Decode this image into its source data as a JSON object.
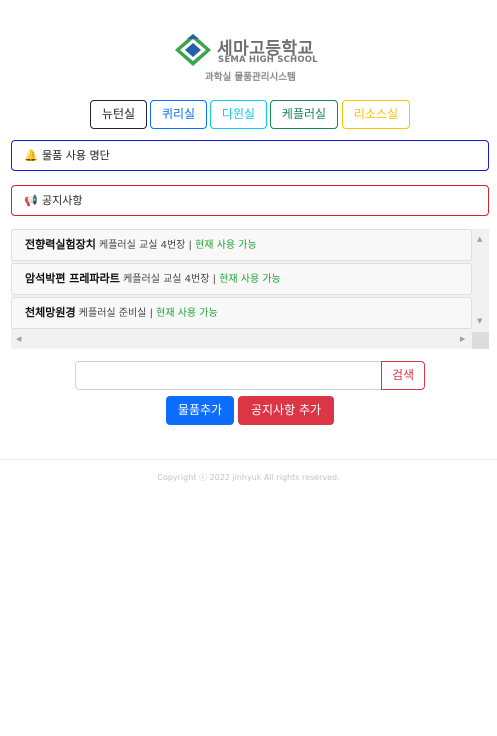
{
  "logo": {
    "name_kr": "세마고등학교",
    "name_en": "SEMA HIGH SCHOOL",
    "system_name": "과학실 물품관리시스템",
    "colors": {
      "green": "#3aa54a",
      "blue": "#2460a8"
    }
  },
  "tabs": [
    {
      "label": "뉴턴실",
      "color": "#212529"
    },
    {
      "label": "퀴리실",
      "color": "#0d6efd"
    },
    {
      "label": "다윈실",
      "color": "#0dcaf0"
    },
    {
      "label": "케플러실",
      "color": "#198754"
    },
    {
      "label": "리소스실",
      "color": "#ffc107"
    }
  ],
  "usage_panel": {
    "icon": "bell-icon",
    "label": "물품 사용 명단"
  },
  "notice_panel": {
    "icon": "megaphone-icon",
    "label": "공지사항"
  },
  "items": [
    {
      "name": "전향력실험장치",
      "location": "케플러실 교실 4번장",
      "separator": "|",
      "status": "현재 사용 가능"
    },
    {
      "name": "암석박편 프레파라트",
      "location": "케플러실 교실 4번장",
      "separator": "|",
      "status": "현재 사용 가능"
    },
    {
      "name": "천체망원경",
      "location": "케플러실 준비실",
      "separator": "|",
      "status": "현재 사용 가능"
    }
  ],
  "search": {
    "placeholder": "",
    "button_label": "검색"
  },
  "buttons": {
    "add_item": "물품추가",
    "add_notice": "공지사항 추가"
  },
  "footer": {
    "text": "Copyright ⓒ 2022 jinhyuk All rights reserved."
  }
}
